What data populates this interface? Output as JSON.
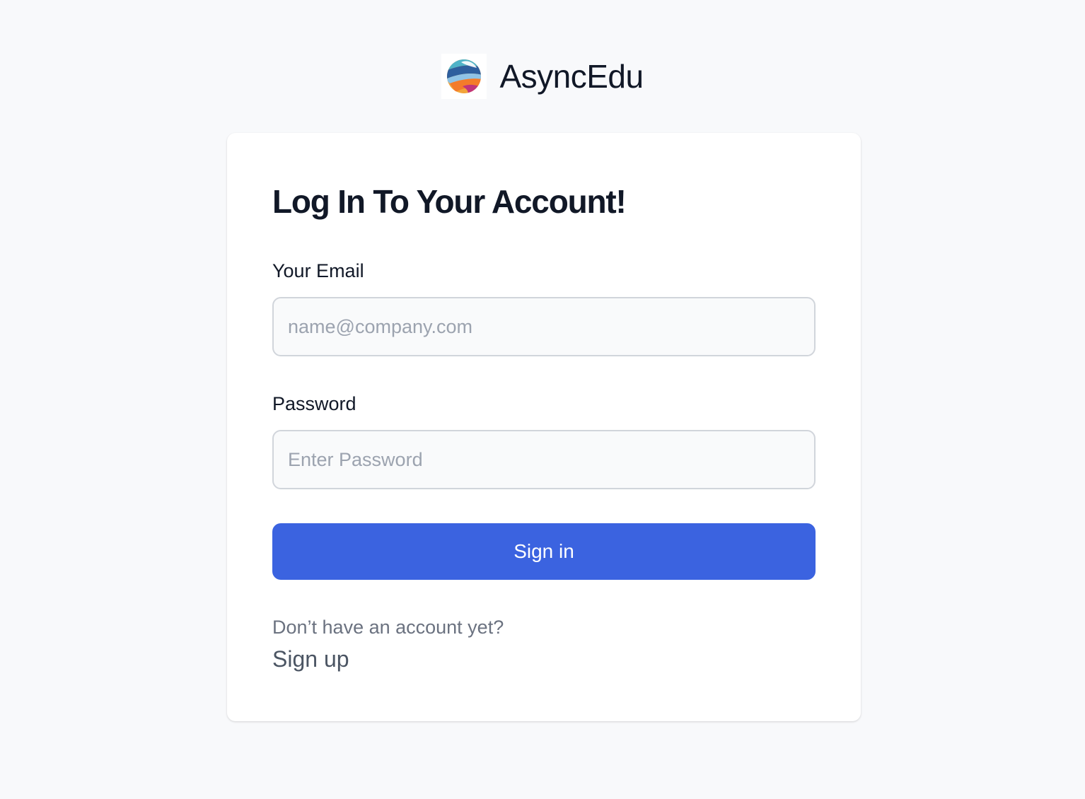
{
  "brand": {
    "name": "AsyncEdu",
    "logo_icon": "asyncedu-globe-logo"
  },
  "login": {
    "title": "Log In To Your Account!",
    "email_label": "Your Email",
    "email_placeholder": "name@company.com",
    "email_value": "",
    "password_label": "Password",
    "password_placeholder": "Enter Password",
    "password_value": "",
    "submit_label": "Sign in",
    "no_account_text": "Don’t have an account yet?",
    "signup_link": "Sign up"
  },
  "colors": {
    "page_background": "#f8f9fb",
    "card_background": "#ffffff",
    "primary_button": "#3b63e0",
    "text_primary": "#111827",
    "text_muted": "#6b7280"
  }
}
